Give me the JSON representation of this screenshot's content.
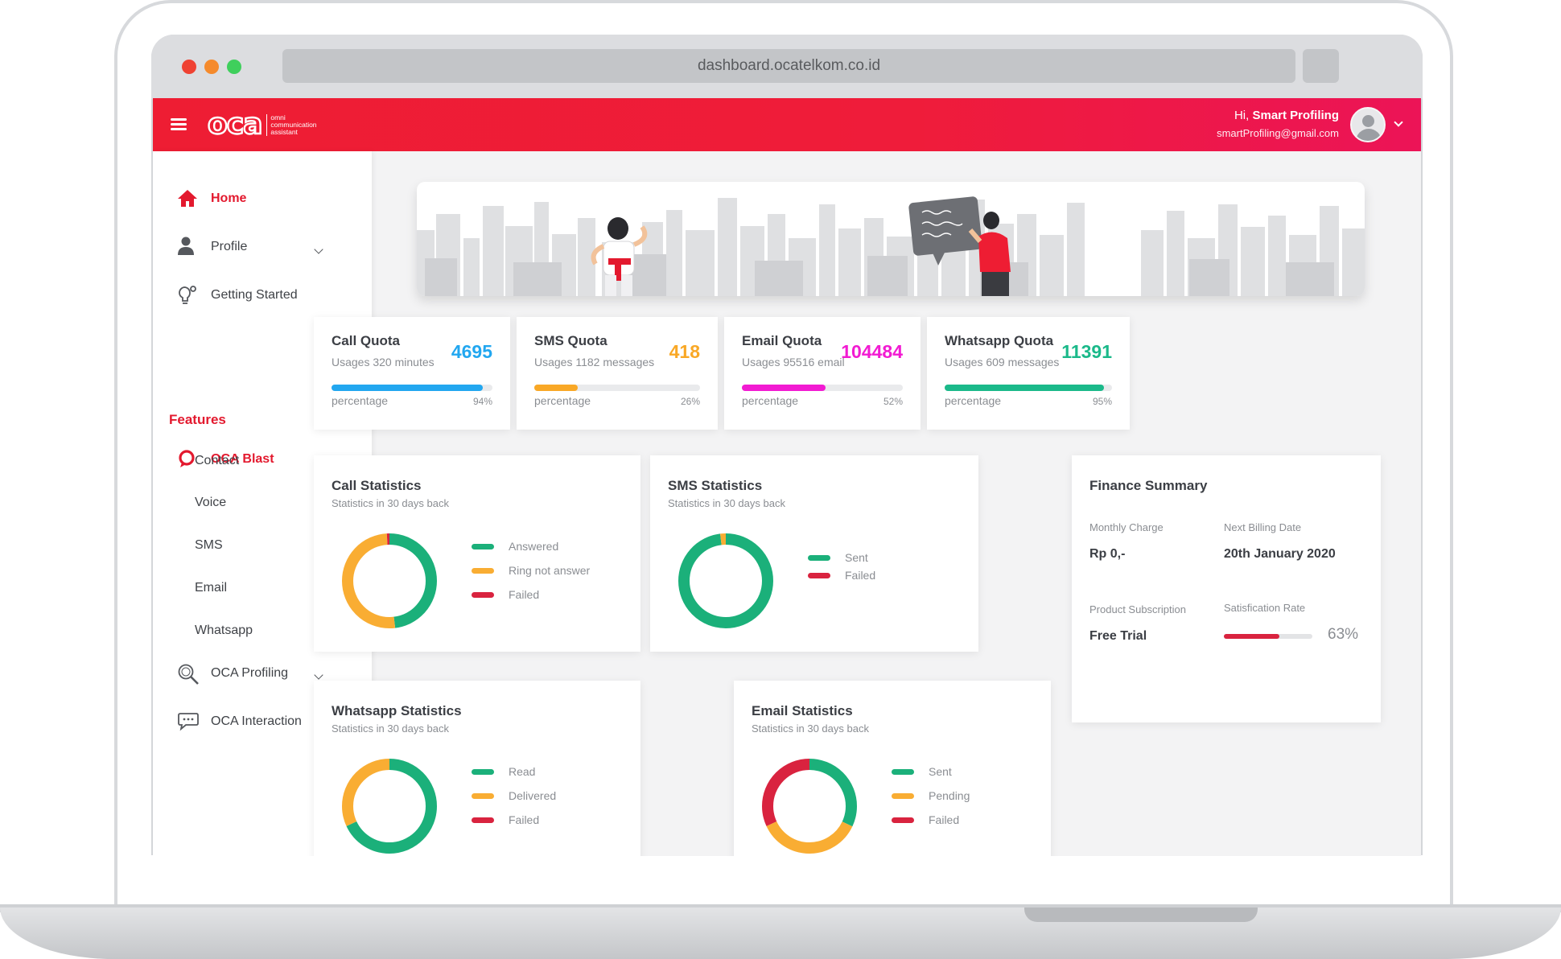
{
  "browser": {
    "url": "dashboard.ocatelkom.co.id"
  },
  "header": {
    "logo_text": "oca",
    "logo_tagline": "omni communication assistant",
    "greeting_prefix": "Hi,",
    "user_name": "Smart Profiling",
    "user_email": "smartProfiling@gmail.com"
  },
  "sidebar": {
    "home": "Home",
    "profile": "Profile",
    "getting_started": "Getting Started",
    "features_heading": "Features",
    "oca_blast": "OCA Blast",
    "sub_items": [
      "Contact",
      "Voice",
      "SMS",
      "Email",
      "Whatsapp"
    ],
    "oca_profiling": "OCA Profiling",
    "oca_interaction": "OCA Interaction"
  },
  "quotas": [
    {
      "title": "Call Quota",
      "usage": "Usages 320 minutes",
      "value": "4695",
      "label": "percentage",
      "percent": 94,
      "percent_text": "94%",
      "color": "#22a7f0"
    },
    {
      "title": "SMS Quota",
      "usage": "Usages 1182 messages",
      "value": "418",
      "label": "percentage",
      "percent": 26,
      "percent_text": "26%",
      "color": "#f9a826"
    },
    {
      "title": "Email Quota",
      "usage": "Usages 95516 email",
      "value": "104484",
      "label": "percentage",
      "percent": 52,
      "percent_text": "52%",
      "color": "#f21bd2"
    },
    {
      "title": "Whatsapp Quota",
      "usage": "Usages 609 messages",
      "value": "11391",
      "label": "percentage",
      "percent": 95,
      "percent_text": "95%",
      "color": "#1bb98a"
    }
  ],
  "stats": {
    "call": {
      "title": "Call Statistics",
      "subtitle": "Statistics in 30 days back",
      "legend": [
        "Answered",
        "Ring not answer",
        "Failed"
      ]
    },
    "sms": {
      "title": "SMS Statistics",
      "subtitle": "Statistics in 30 days back",
      "legend": [
        "Sent",
        "Failed"
      ]
    },
    "whatsapp": {
      "title": "Whatsapp Statistics",
      "subtitle": "Statistics in 30 days back",
      "legend": [
        "Read",
        "Delivered",
        "Failed"
      ]
    },
    "email": {
      "title": "Email Statistics",
      "subtitle": "Statistics in 30 days back",
      "legend": [
        "Sent",
        "Pending",
        "Failed"
      ]
    }
  },
  "colors": {
    "green": "#1bb07a",
    "orange": "#f9ad33",
    "red": "#d9233f",
    "brand": "#ee1d33"
  },
  "chart_data": [
    {
      "type": "pie",
      "name": "Call Statistics",
      "categories": [
        "Answered",
        "Ring not answer",
        "Failed"
      ],
      "values": [
        48,
        51,
        1
      ]
    },
    {
      "type": "pie",
      "name": "SMS Statistics",
      "categories": [
        "Sent",
        "Failed"
      ],
      "values": [
        98,
        2
      ]
    },
    {
      "type": "pie",
      "name": "Whatsapp Statistics",
      "categories": [
        "Read",
        "Delivered",
        "Failed"
      ],
      "values": [
        68,
        32,
        0
      ]
    },
    {
      "type": "pie",
      "name": "Email Statistics",
      "categories": [
        "Sent",
        "Pending",
        "Failed"
      ],
      "values": [
        32,
        36,
        32
      ]
    }
  ],
  "finance": {
    "title": "Finance Summary",
    "monthly_charge_label": "Monthly Charge",
    "monthly_charge": "Rp 0,-",
    "next_billing_label": "Next Billing Date",
    "next_billing": "20th January 2020",
    "subscription_label": "Product Subscription",
    "subscription": "Free Trial",
    "satisfaction_label": "Satisfication Rate",
    "satisfaction_percent": 63,
    "satisfaction_text": "63%"
  }
}
